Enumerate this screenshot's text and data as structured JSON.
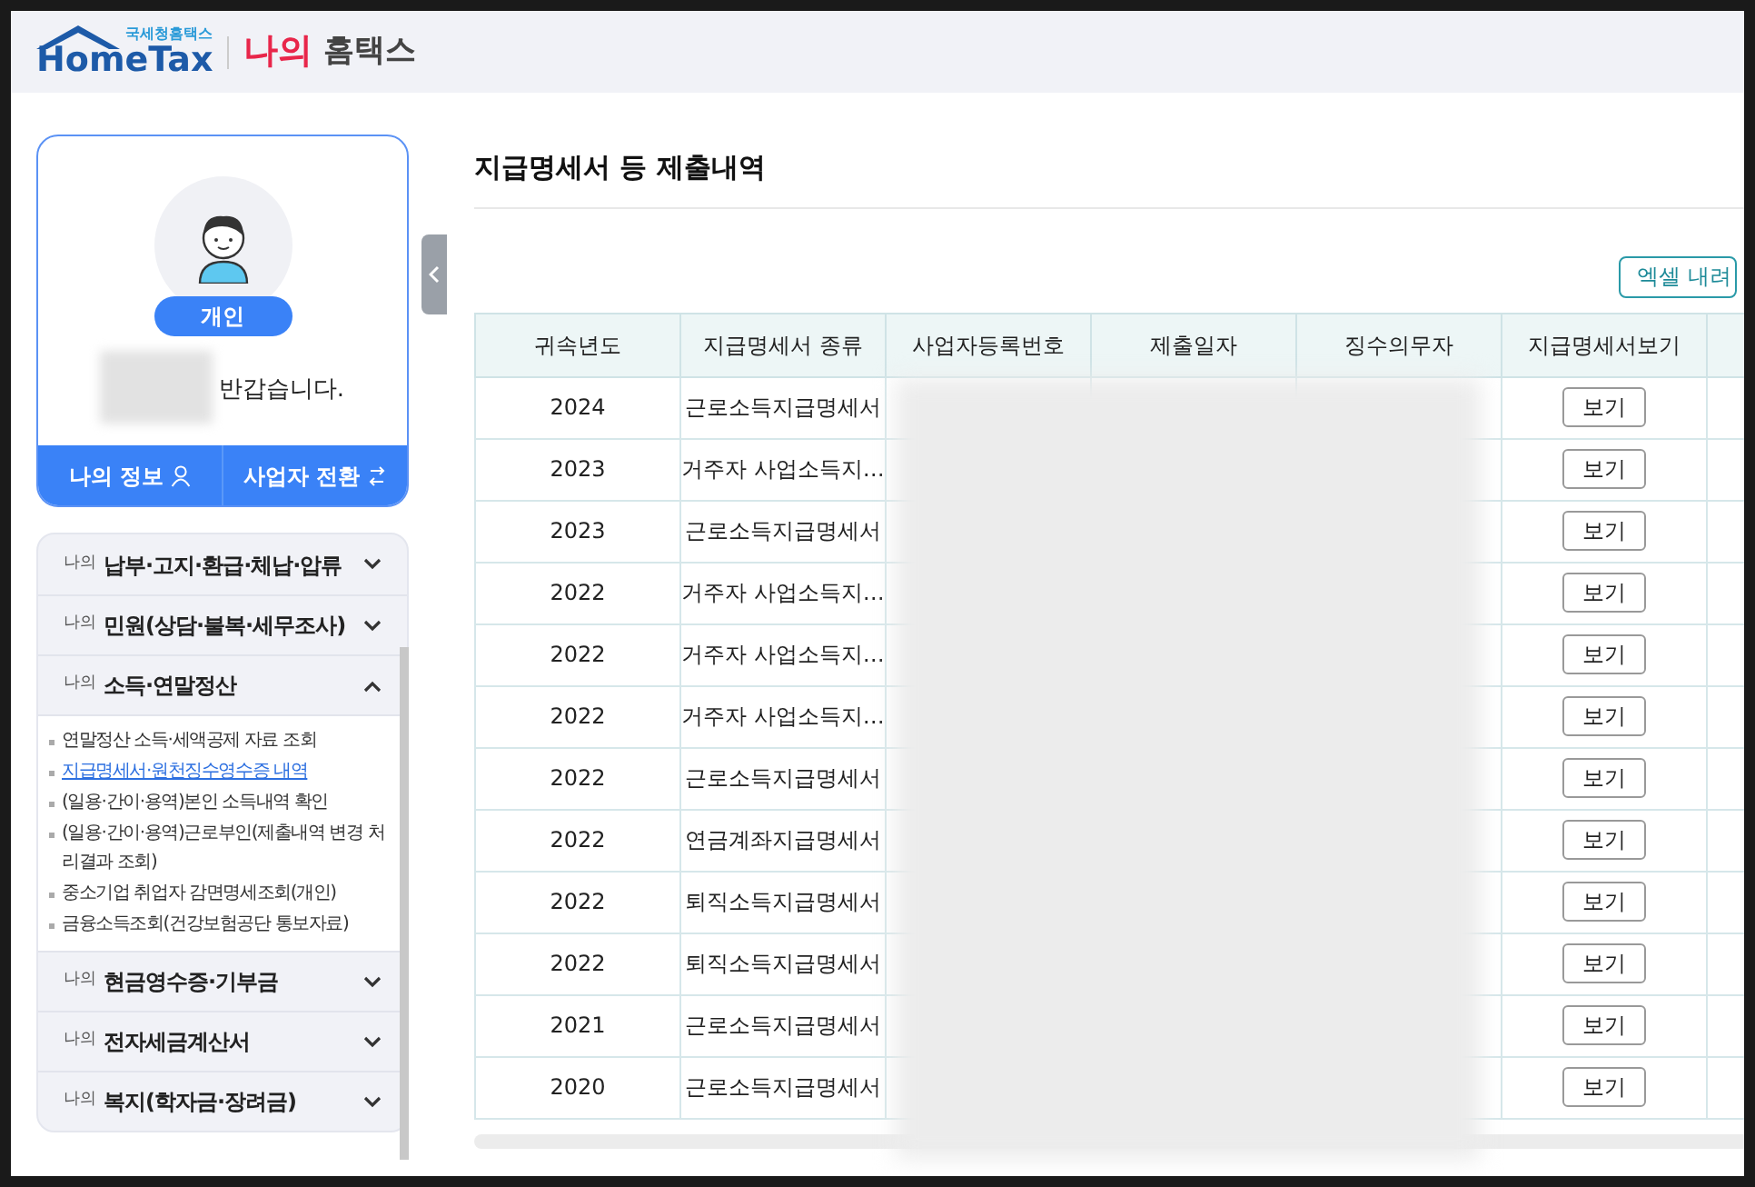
{
  "header": {
    "logo_caption": "국세청홈택스",
    "logo_text": "HomeTax",
    "title_highlight": "나의",
    "title": "홈택스"
  },
  "profile": {
    "badge": "개인",
    "greeting": "반갑습니다.",
    "buttons": [
      {
        "label": "나의 정보",
        "kind": "person"
      },
      {
        "label": "사업자 전환",
        "kind": "switch"
      }
    ]
  },
  "menu": [
    {
      "prefix": "나의",
      "title": "납부·고지·환급·체납·압류",
      "expanded": false
    },
    {
      "prefix": "나의",
      "title": "민원(상담·불복·세무조사)",
      "expanded": false
    },
    {
      "prefix": "나의",
      "title": "소득·연말정산",
      "expanded": true,
      "children": [
        {
          "label": "연말정산 소득·세액공제 자료 조회",
          "selected": false
        },
        {
          "label": "지급명세서·원천징수영수증 내역",
          "selected": true
        },
        {
          "label": "(일용·간이·용역)본인 소득내역 확인",
          "selected": false
        },
        {
          "label": "(일용·간이·용역)근로부인(제출내역 변경 처리결과 조회)",
          "selected": false
        },
        {
          "label": "중소기업 취업자 감면명세조회(개인)",
          "selected": false
        },
        {
          "label": "금융소득조회(건강보험공단 통보자료)",
          "selected": false
        }
      ]
    },
    {
      "prefix": "나의",
      "title": "현금영수증·기부금",
      "expanded": false
    },
    {
      "prefix": "나의",
      "title": "전자세금계산서",
      "expanded": false
    },
    {
      "prefix": "나의",
      "title": "복지(학자금·장려금)",
      "expanded": false
    }
  ],
  "page_title": "지급명세서 등 제출내역",
  "excel_button": "엑셀 내려",
  "table": {
    "columns": [
      "귀속년도",
      "지급명세서 종류",
      "사업자등록번호",
      "제출일자",
      "징수의무자",
      "지급명세서보기"
    ],
    "rows": [
      {
        "year": "2024",
        "type": "근로소득지급명세서",
        "view": "보기"
      },
      {
        "year": "2023",
        "type": "거주자 사업소득지…",
        "view": "보기"
      },
      {
        "year": "2023",
        "type": "근로소득지급명세서",
        "view": "보기"
      },
      {
        "year": "2022",
        "type": "거주자 사업소득지…",
        "view": "보기"
      },
      {
        "year": "2022",
        "type": "거주자 사업소득지…",
        "view": "보기"
      },
      {
        "year": "2022",
        "type": "거주자 사업소득지…",
        "view": "보기"
      },
      {
        "year": "2022",
        "type": "근로소득지급명세서",
        "view": "보기"
      },
      {
        "year": "2022",
        "type": "연금계좌지급명세서",
        "view": "보기"
      },
      {
        "year": "2022",
        "type": "퇴직소득지급명세서",
        "view": "보기"
      },
      {
        "year": "2022",
        "type": "퇴직소득지급명세서",
        "view": "보기"
      },
      {
        "year": "2021",
        "type": "근로소득지급명세서",
        "view": "보기"
      },
      {
        "year": "2020",
        "type": "근로소득지급명세서",
        "view": "보기"
      }
    ]
  }
}
